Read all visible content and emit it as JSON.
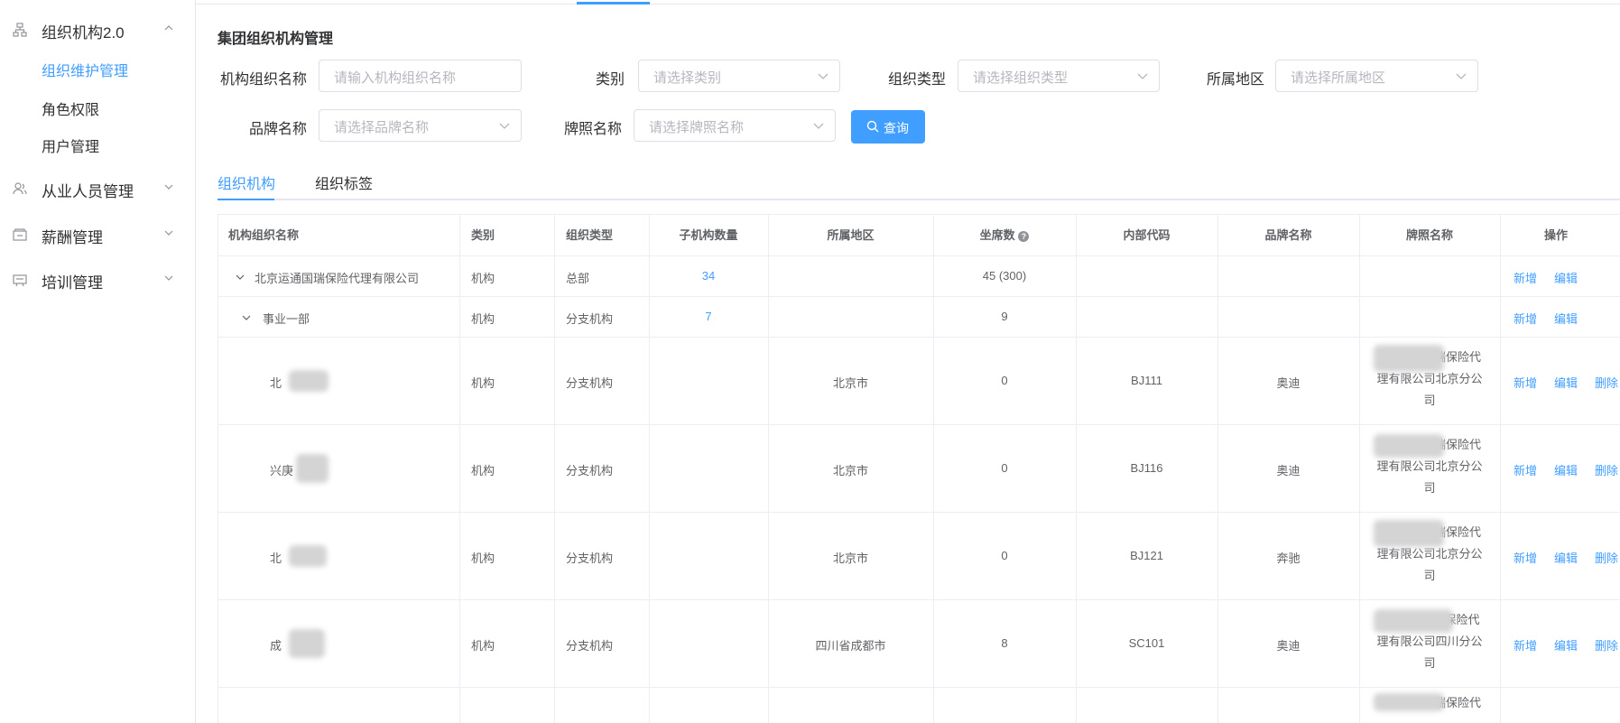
{
  "sidebar": {
    "groups": [
      {
        "label": "组织机构2.0",
        "icon": "org-tree-icon",
        "expanded": true,
        "items": [
          {
            "label": "组织维护管理",
            "active": true
          },
          {
            "label": "角色权限"
          },
          {
            "label": "用户管理"
          }
        ]
      },
      {
        "label": "从业人员管理",
        "icon": "users-icon"
      },
      {
        "label": "薪酬管理",
        "icon": "wallet-icon"
      },
      {
        "label": "培训管理",
        "icon": "training-icon"
      }
    ]
  },
  "page": {
    "title": "集团组织机构管理"
  },
  "filters": {
    "org_name": {
      "label": "机构组织名称",
      "placeholder": "请输入机构组织名称"
    },
    "category": {
      "label": "类别",
      "placeholder": "请选择类别"
    },
    "org_type": {
      "label": "组织类型",
      "placeholder": "请选择组织类型"
    },
    "region": {
      "label": "所属地区",
      "placeholder": "请选择所属地区"
    },
    "brand": {
      "label": "品牌名称",
      "placeholder": "请选择品牌名称"
    },
    "license": {
      "label": "牌照名称",
      "placeholder": "请选择牌照名称"
    },
    "query_button": "查询"
  },
  "tabs": [
    {
      "label": "组织机构",
      "active": true
    },
    {
      "label": "组织标签"
    }
  ],
  "table": {
    "columns": [
      "机构组织名称",
      "类别",
      "组织类型",
      "子机构数量",
      "所属地区",
      "坐席数",
      "内部代码",
      "品牌名称",
      "牌照名称",
      "操作"
    ],
    "rows": [
      {
        "name": "北京运通国瑞保险代理有限公司",
        "category": "机构",
        "type": "总部",
        "children": "34",
        "region": "",
        "seats": "45 (300)",
        "code": "",
        "brand": "",
        "license": [],
        "actions": [
          "新增",
          "编辑"
        ]
      },
      {
        "name": "事业一部",
        "category": "机构",
        "type": "分支机构",
        "children": "7",
        "region": "",
        "seats": "9",
        "code": "",
        "brand": "",
        "license": [],
        "actions": [
          "新增",
          "编辑"
        ]
      },
      {
        "name": "北",
        "category": "机构",
        "type": "分支机构",
        "children": "",
        "region": "北京市",
        "seats": "0",
        "code": "BJ111",
        "brand": "奥迪",
        "license": [
          "瑞保险代",
          "理有限公司北京分公",
          "司"
        ],
        "actions": [
          "新增",
          "编辑",
          "删除"
        ]
      },
      {
        "name": "兴庚",
        "category": "机构",
        "type": "分支机构",
        "children": "",
        "region": "北京市",
        "seats": "0",
        "code": "BJ116",
        "brand": "奥迪",
        "license": [
          "瑞保险代",
          "理有限公司北京分公",
          "司"
        ],
        "actions": [
          "新增",
          "编辑",
          "删除"
        ]
      },
      {
        "name": "北",
        "category": "机构",
        "type": "分支机构",
        "children": "",
        "region": "北京市",
        "seats": "0",
        "code": "BJ121",
        "brand": "奔驰",
        "license": [
          "瑞保险代",
          "理有限公司北京分公",
          "司"
        ],
        "actions": [
          "新增",
          "编辑",
          "删除"
        ]
      },
      {
        "name": "成",
        "category": "机构",
        "type": "分支机构",
        "children": "",
        "region": "四川省成都市",
        "seats": "8",
        "code": "SC101",
        "brand": "奥迪",
        "license": [
          "保险代",
          "理有限公司四川分公",
          "司"
        ],
        "actions": [
          "新增",
          "编辑",
          "删除"
        ]
      },
      {
        "name": "",
        "category": "",
        "type": "",
        "children": "",
        "region": "",
        "seats": "",
        "code": "",
        "brand": "",
        "license": [
          "瑞保险代"
        ],
        "actions": []
      }
    ]
  },
  "colors": {
    "primary": "#409eff",
    "border": "#dcdfe6",
    "text": "#303133",
    "muted": "#606266"
  }
}
